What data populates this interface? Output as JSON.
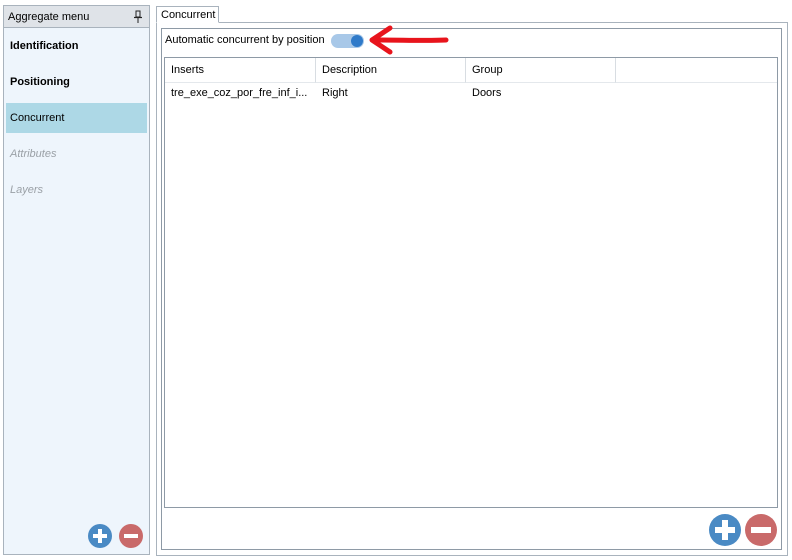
{
  "aggregate_menu": {
    "title": "Aggregate menu",
    "items": [
      {
        "label": "Identification",
        "state": "bold"
      },
      {
        "label": "Positioning",
        "state": "bold"
      },
      {
        "label": "Concurrent",
        "state": "selected"
      },
      {
        "label": "Attributes",
        "state": "disabled"
      },
      {
        "label": "Layers",
        "state": "disabled"
      }
    ],
    "icons": {
      "pin": "pin-icon",
      "add": "add-icon",
      "remove": "remove-icon"
    }
  },
  "tabs": [
    {
      "label": "Concurrent"
    }
  ],
  "concurrent": {
    "auto_label": "Automatic concurrent by position",
    "toggle_on": true,
    "columns": [
      "Inserts",
      "Description",
      "Group"
    ],
    "rows": [
      {
        "inserts": "tre_exe_coz_por_fre_inf_i...",
        "description": "Right",
        "group": "Doors"
      }
    ]
  },
  "colors": {
    "selected_item": "#add8e6",
    "toggle_track": "#a8c8e8",
    "toggle_knob": "#2f7ac9",
    "add_button": "#4a8ac4",
    "remove_button": "#c96a6a",
    "annotation_arrow": "#e8141c"
  }
}
